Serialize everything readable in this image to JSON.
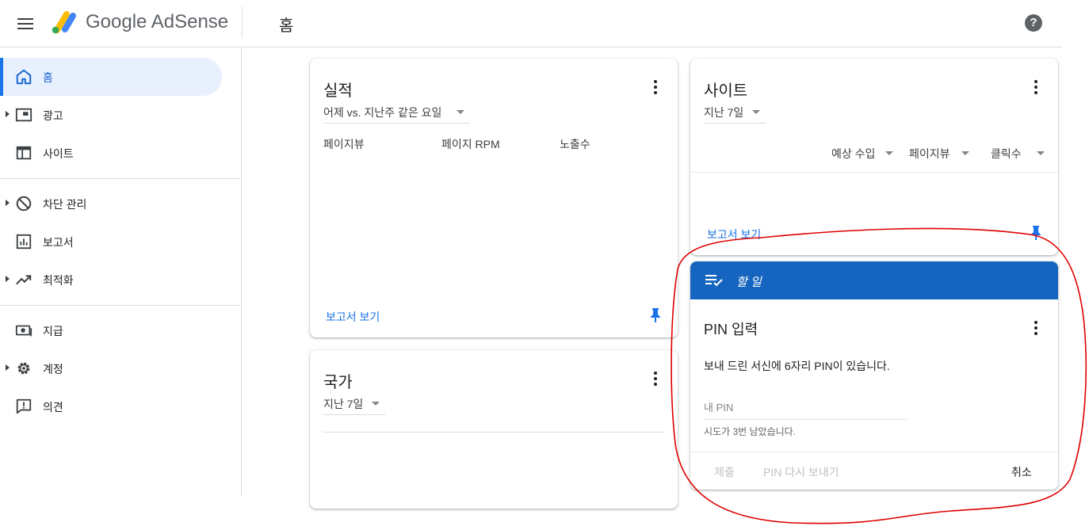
{
  "header": {
    "brand": "Google AdSense",
    "page_title": "홈",
    "help": "?"
  },
  "sidebar": {
    "items": [
      {
        "label": "홈",
        "icon": "home-icon"
      },
      {
        "label": "광고",
        "icon": "ads-icon"
      },
      {
        "label": "사이트",
        "icon": "sites-icon"
      },
      {
        "label": "차단 관리",
        "icon": "block-icon"
      },
      {
        "label": "보고서",
        "icon": "reports-icon"
      },
      {
        "label": "최적화",
        "icon": "trending-icon"
      },
      {
        "label": "지급",
        "icon": "payments-icon"
      },
      {
        "label": "계정",
        "icon": "settings-icon"
      },
      {
        "label": "의견",
        "icon": "feedback-icon"
      }
    ]
  },
  "performance": {
    "title": "실적",
    "range": "어제 vs. 지난주 같은 요일",
    "columns": [
      "페이지뷰",
      "페이지 RPM",
      "노출수"
    ],
    "report_link": "보고서 보기"
  },
  "country": {
    "title": "국가",
    "range": "지난 7일"
  },
  "sites": {
    "title": "사이트",
    "range": "지난 7일",
    "metrics": [
      "예상 수입",
      "페이지뷰",
      "클릭수"
    ],
    "report_link": "보고서 보기"
  },
  "todo": {
    "header": "할 일",
    "title": "PIN 입력",
    "description": "보내 드린 서신에 6자리 PIN이 있습니다.",
    "pin_placeholder": "내 PIN",
    "attempts_text": "시도가 3번 남았습니다.",
    "submit": "제출",
    "resend": "PIN 다시 보내기",
    "cancel": "취소"
  },
  "colors": {
    "accent": "#1a73e8",
    "todo_header": "#1565c0",
    "annotation": "#e00000"
  }
}
